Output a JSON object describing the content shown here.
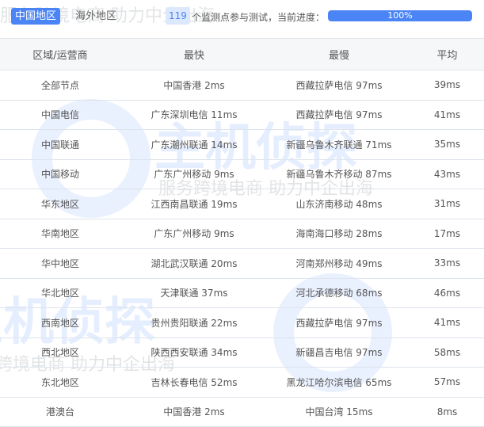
{
  "tabs": [
    {
      "label": "中国地区",
      "active": true
    },
    {
      "label": "海外地区",
      "active": false
    }
  ],
  "status": {
    "count": "119",
    "text": "个监测点参与测试，当前进度：",
    "progress_percent": 100,
    "progress_label": "100%"
  },
  "columns": [
    "区域/运营商",
    "最快",
    "最慢",
    "平均"
  ],
  "rows": [
    [
      "全部节点",
      "中国香港 2ms",
      "西藏拉萨电信 97ms",
      "39ms"
    ],
    [
      "中国电信",
      "广东深圳电信 11ms",
      "西藏拉萨电信 97ms",
      "41ms"
    ],
    [
      "中国联通",
      "广东潮州联通 14ms",
      "新疆乌鲁木齐联通 71ms",
      "35ms"
    ],
    [
      "中国移动",
      "广东广州移动 9ms",
      "新疆乌鲁木齐移动 87ms",
      "43ms"
    ],
    [
      "华东地区",
      "江西南昌联通 19ms",
      "山东济南移动 48ms",
      "31ms"
    ],
    [
      "华南地区",
      "广东广州移动 9ms",
      "海南海口移动 28ms",
      "17ms"
    ],
    [
      "华中地区",
      "湖北武汉联通 20ms",
      "河南郑州移动 49ms",
      "33ms"
    ],
    [
      "华北地区",
      "天津联通 37ms",
      "河北承德移动 68ms",
      "46ms"
    ],
    [
      "西南地区",
      "贵州贵阳联通 22ms",
      "西藏拉萨电信 97ms",
      "41ms"
    ],
    [
      "西北地区",
      "陕西西安联通 34ms",
      "新疆昌吉电信 97ms",
      "58ms"
    ],
    [
      "东北地区",
      "吉林长春电信 52ms",
      "黑龙江哈尔滨电信 65ms",
      "57ms"
    ],
    [
      "港澳台",
      "中国香港 2ms",
      "中国台湾 15ms",
      "8ms"
    ]
  ],
  "watermark": {
    "logo": "主机侦探",
    "slogan": "服务跨境电商 助力中企出海"
  },
  "colors": {
    "accent": "#4a84f5"
  }
}
